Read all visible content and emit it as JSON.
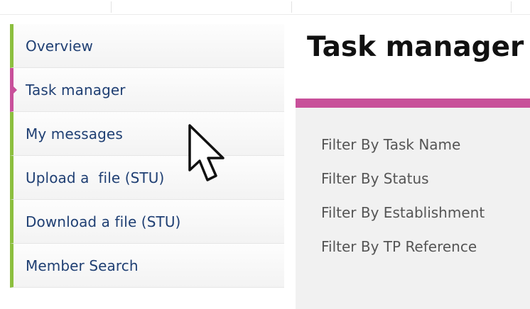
{
  "sidebar": {
    "items": [
      {
        "label": "Overview",
        "active": false
      },
      {
        "label": "Task manager",
        "active": true
      },
      {
        "label": "My messages",
        "active": false
      },
      {
        "label": "Upload a  file (STU)",
        "active": false
      },
      {
        "label": "Download a file (STU)",
        "active": false
      },
      {
        "label": "Member Search",
        "active": false
      }
    ]
  },
  "main": {
    "title": "Task manager",
    "filters": [
      "Filter By Task Name",
      "Filter By Status",
      "Filter By Establishment",
      "Filter By TP Reference"
    ]
  },
  "colors": {
    "nav_border": "#8cbf3f",
    "active_accent": "#c8509a",
    "nav_text": "#1f3f73",
    "filter_text": "#555555",
    "filter_panel": "#f1f1f1"
  },
  "icons": {
    "cursor": "mouse-pointer-icon"
  }
}
